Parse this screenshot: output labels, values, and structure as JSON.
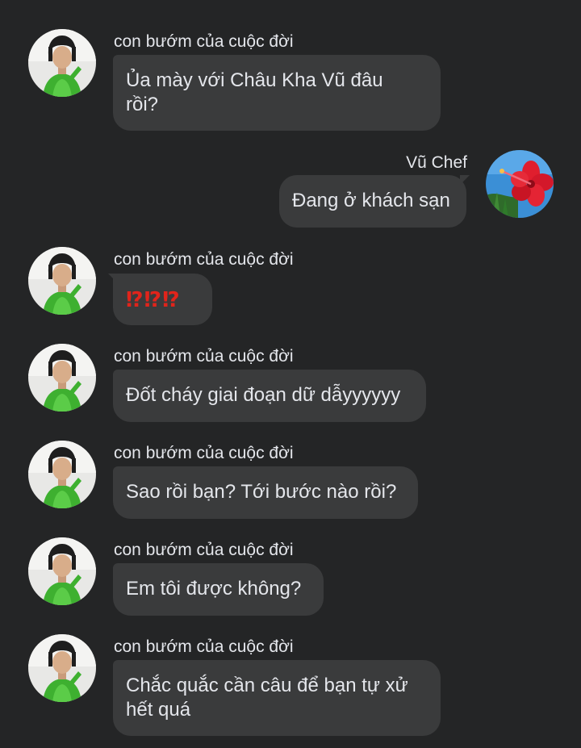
{
  "conversation": {
    "messages": [
      {
        "sender": "con bướm của cuộc đời",
        "text": "Ủa mày với Châu Kha Vũ đâu rồi?",
        "line1": "Ủa mày với Châu Kha Vũ đâu",
        "line2": "rồi?"
      },
      {
        "sender": "Vũ Chef",
        "text": "Đang ở khách sạn"
      },
      {
        "sender": "con bướm của cuộc đời",
        "text": "⁉⁉⁉"
      },
      {
        "sender": "con bướm của cuộc đời",
        "text": "Đốt cháy giai đoạn dữ dẫyyyyyy"
      },
      {
        "sender": "con bướm của cuộc đời",
        "text": "Sao rồi bạn? Tới bước nào rồi?"
      },
      {
        "sender": "con bướm của cuộc đời",
        "text": "Em tôi được không?"
      },
      {
        "sender": "con bướm của cuộc đời",
        "text": "Chắc quắc cần câu để bạn tự xử hết quá",
        "line1": "Chắc quắc cần câu để bạn tự xử",
        "line2": "hết quá"
      }
    ]
  },
  "avatars": {
    "other": "person-avatar-icon",
    "self": "hibiscus-flower-avatar-icon"
  },
  "colors": {
    "background": "#242526",
    "bubble": "#3a3b3c",
    "text": "#e4e6eb",
    "emphasis": "#e0241b"
  }
}
